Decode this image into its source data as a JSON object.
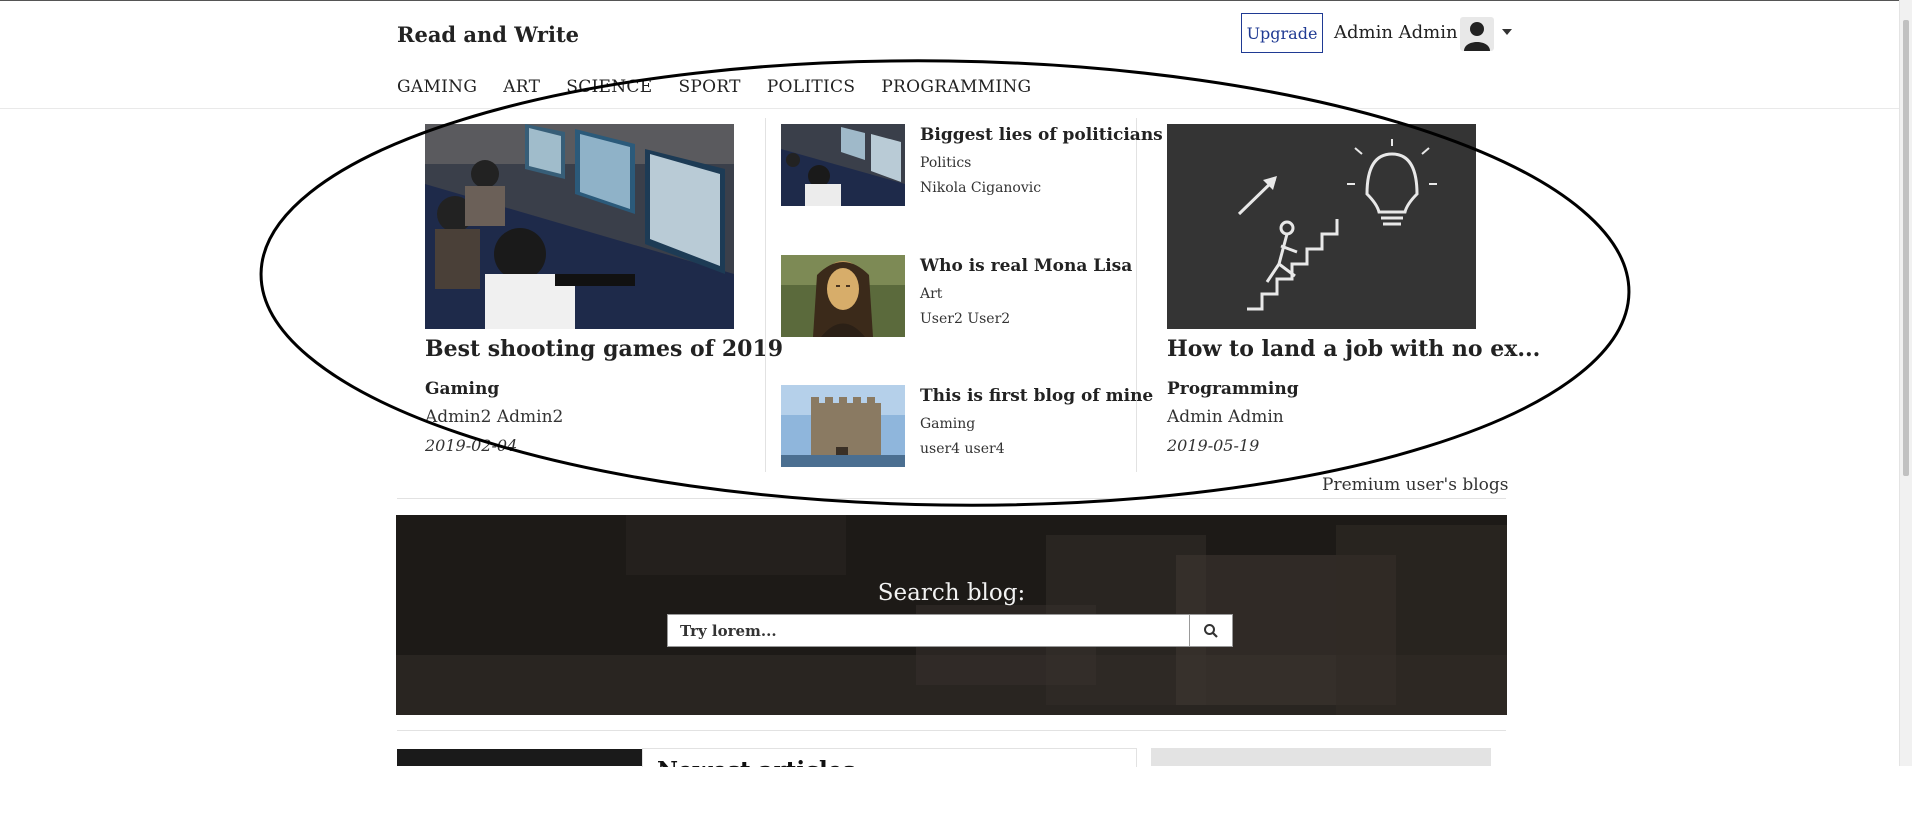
{
  "header": {
    "brand": "Read and Write",
    "upgrade_label": "Upgrade",
    "username": "Admin Admin"
  },
  "nav": [
    "GAMING",
    "ART",
    "SCIENCE",
    "SPORT",
    "POLITICS",
    "PROGRAMMING"
  ],
  "featured_left": {
    "title": "Best shooting games of 2019",
    "category": "Gaming",
    "author": "Admin2 Admin2",
    "date": "2019-02-04"
  },
  "featured_middle": [
    {
      "title": "Biggest lies of politicians",
      "category": "Politics",
      "author": "Nikola Ciganovic"
    },
    {
      "title": "Who is real Mona Lisa",
      "category": "Art",
      "author": "User2 User2"
    },
    {
      "title": "This is first blog of mine",
      "category": "Gaming",
      "author": "user4 user4"
    }
  ],
  "featured_right": {
    "title": "How to land a job with no ex...",
    "category": "Programming",
    "author": "Admin Admin",
    "date": "2019-05-19"
  },
  "premium_link": "Premium user's blogs",
  "search": {
    "title": "Search blog:",
    "placeholder": "Try lorem..."
  },
  "bottom": {
    "partial_title": "Newest articles"
  },
  "icons": {
    "avatar": "user-icon",
    "dropdown": "caret-down-icon",
    "search": "search-icon"
  },
  "colors": {
    "accent": "#1f3a93",
    "hero_bg": "#2a2622"
  }
}
